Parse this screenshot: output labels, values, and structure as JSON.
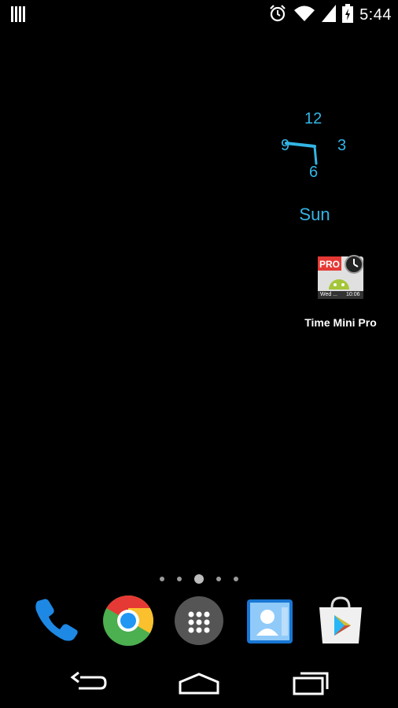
{
  "status_bar": {
    "time": "5:44",
    "icons": [
      "notification-bars-icon",
      "alarm-icon",
      "wifi-icon",
      "cell-signal-icon",
      "battery-icon"
    ]
  },
  "clock_widget": {
    "numbers": {
      "twelve": "12",
      "three": "3",
      "six": "6",
      "nine": "9"
    },
    "day": "Sun",
    "accent_color": "#33b5e5"
  },
  "app_shortcut": {
    "label": "Time Mini Pro",
    "icon_badge": "PRO",
    "icon_date": "Wed ...",
    "icon_time": "10:06"
  },
  "page_indicator": {
    "count": 5,
    "active_index": 2
  },
  "dock": {
    "items": [
      "phone-icon",
      "chrome-icon",
      "app-drawer-icon",
      "contacts-icon",
      "play-store-icon"
    ]
  },
  "nav_bar": {
    "buttons": [
      "back-icon",
      "home-icon",
      "recents-icon"
    ]
  }
}
